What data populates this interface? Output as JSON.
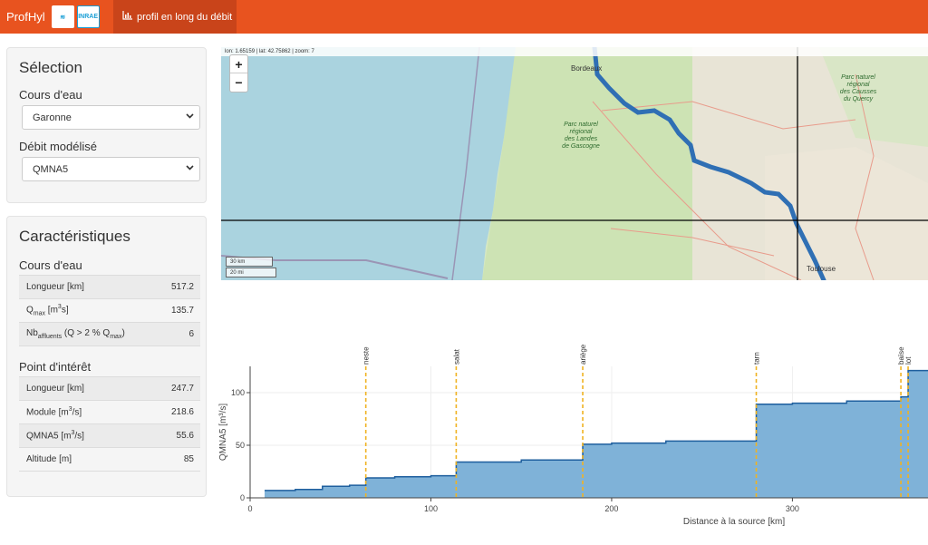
{
  "navbar": {
    "brand": "ProfHyl",
    "logo_a": "≋",
    "logo_b": "INRAE",
    "tab_icon": "chart-icon",
    "tab_label": "profil en long du débit"
  },
  "selection": {
    "title": "Sélection",
    "river_label": "Cours d'eau",
    "river_value": "Garonne",
    "flow_label": "Débit modélisé",
    "flow_value": "QMNA5"
  },
  "characteristics": {
    "title": "Caractéristiques",
    "river_section": "Cours d'eau",
    "river_rows": [
      {
        "label": "Longueur [km]",
        "value": "517.2"
      },
      {
        "value": "135.7"
      },
      {
        "value": "6"
      }
    ],
    "poi_section": "Point d'intérêt",
    "poi_rows": [
      {
        "label": "Longueur [km]",
        "value": "247.7"
      },
      {
        "value": "218.6"
      },
      {
        "value": "55.6"
      },
      {
        "label": "Altitude [m]",
        "value": "85"
      }
    ]
  },
  "map": {
    "coords": "lon: 1.65159 | lat: 42.75862 | zoom: 7",
    "zoom_in": "+",
    "zoom_out": "−",
    "scale_km": "30 km",
    "scale_mi": "20 mi",
    "city_bordeaux": "Bordeaux",
    "city_toulouse": "Toulouse",
    "park_landes": [
      "Parc naturel",
      "régional",
      "des Landes",
      "de Gascogne"
    ],
    "park_quercy": [
      "Parc naturel",
      "régional",
      "des Causses",
      "du Quercy"
    ],
    "colors": {
      "river": "#2f6fb4",
      "sea": "#aad3df",
      "land": "#d7e8c4"
    }
  },
  "chart_data": {
    "type": "area",
    "xlabel": "Distance à la source [km]",
    "ylabel": "QMNA5 [m³/s]",
    "xlim": [
      0,
      375
    ],
    "ylim": [
      0,
      125
    ],
    "xticks": [
      0,
      100,
      200,
      300
    ],
    "yticks": [
      0,
      50,
      100
    ],
    "steps": [
      {
        "x": 8,
        "y": 7
      },
      {
        "x": 25,
        "y": 8
      },
      {
        "x": 40,
        "y": 11
      },
      {
        "x": 55,
        "y": 12
      },
      {
        "x": 64,
        "y": 19
      },
      {
        "x": 80,
        "y": 20
      },
      {
        "x": 100,
        "y": 21
      },
      {
        "x": 114,
        "y": 34
      },
      {
        "x": 150,
        "y": 36
      },
      {
        "x": 184,
        "y": 51
      },
      {
        "x": 200,
        "y": 52
      },
      {
        "x": 230,
        "y": 54
      },
      {
        "x": 280,
        "y": 89
      },
      {
        "x": 300,
        "y": 90
      },
      {
        "x": 330,
        "y": 92
      },
      {
        "x": 360,
        "y": 96
      },
      {
        "x": 364,
        "y": 121
      }
    ],
    "tributaries": [
      {
        "name": "neste",
        "x": 64
      },
      {
        "name": "salat",
        "x": 114
      },
      {
        "name": "ariège",
        "x": 184
      },
      {
        "name": "tarn",
        "x": 280
      },
      {
        "name": "baïse",
        "x": 360
      },
      {
        "name": "lot",
        "x": 364
      }
    ],
    "colors": {
      "fill": "#7fb2d8",
      "line": "#1f5f9e",
      "marker": "#f0b323"
    }
  }
}
